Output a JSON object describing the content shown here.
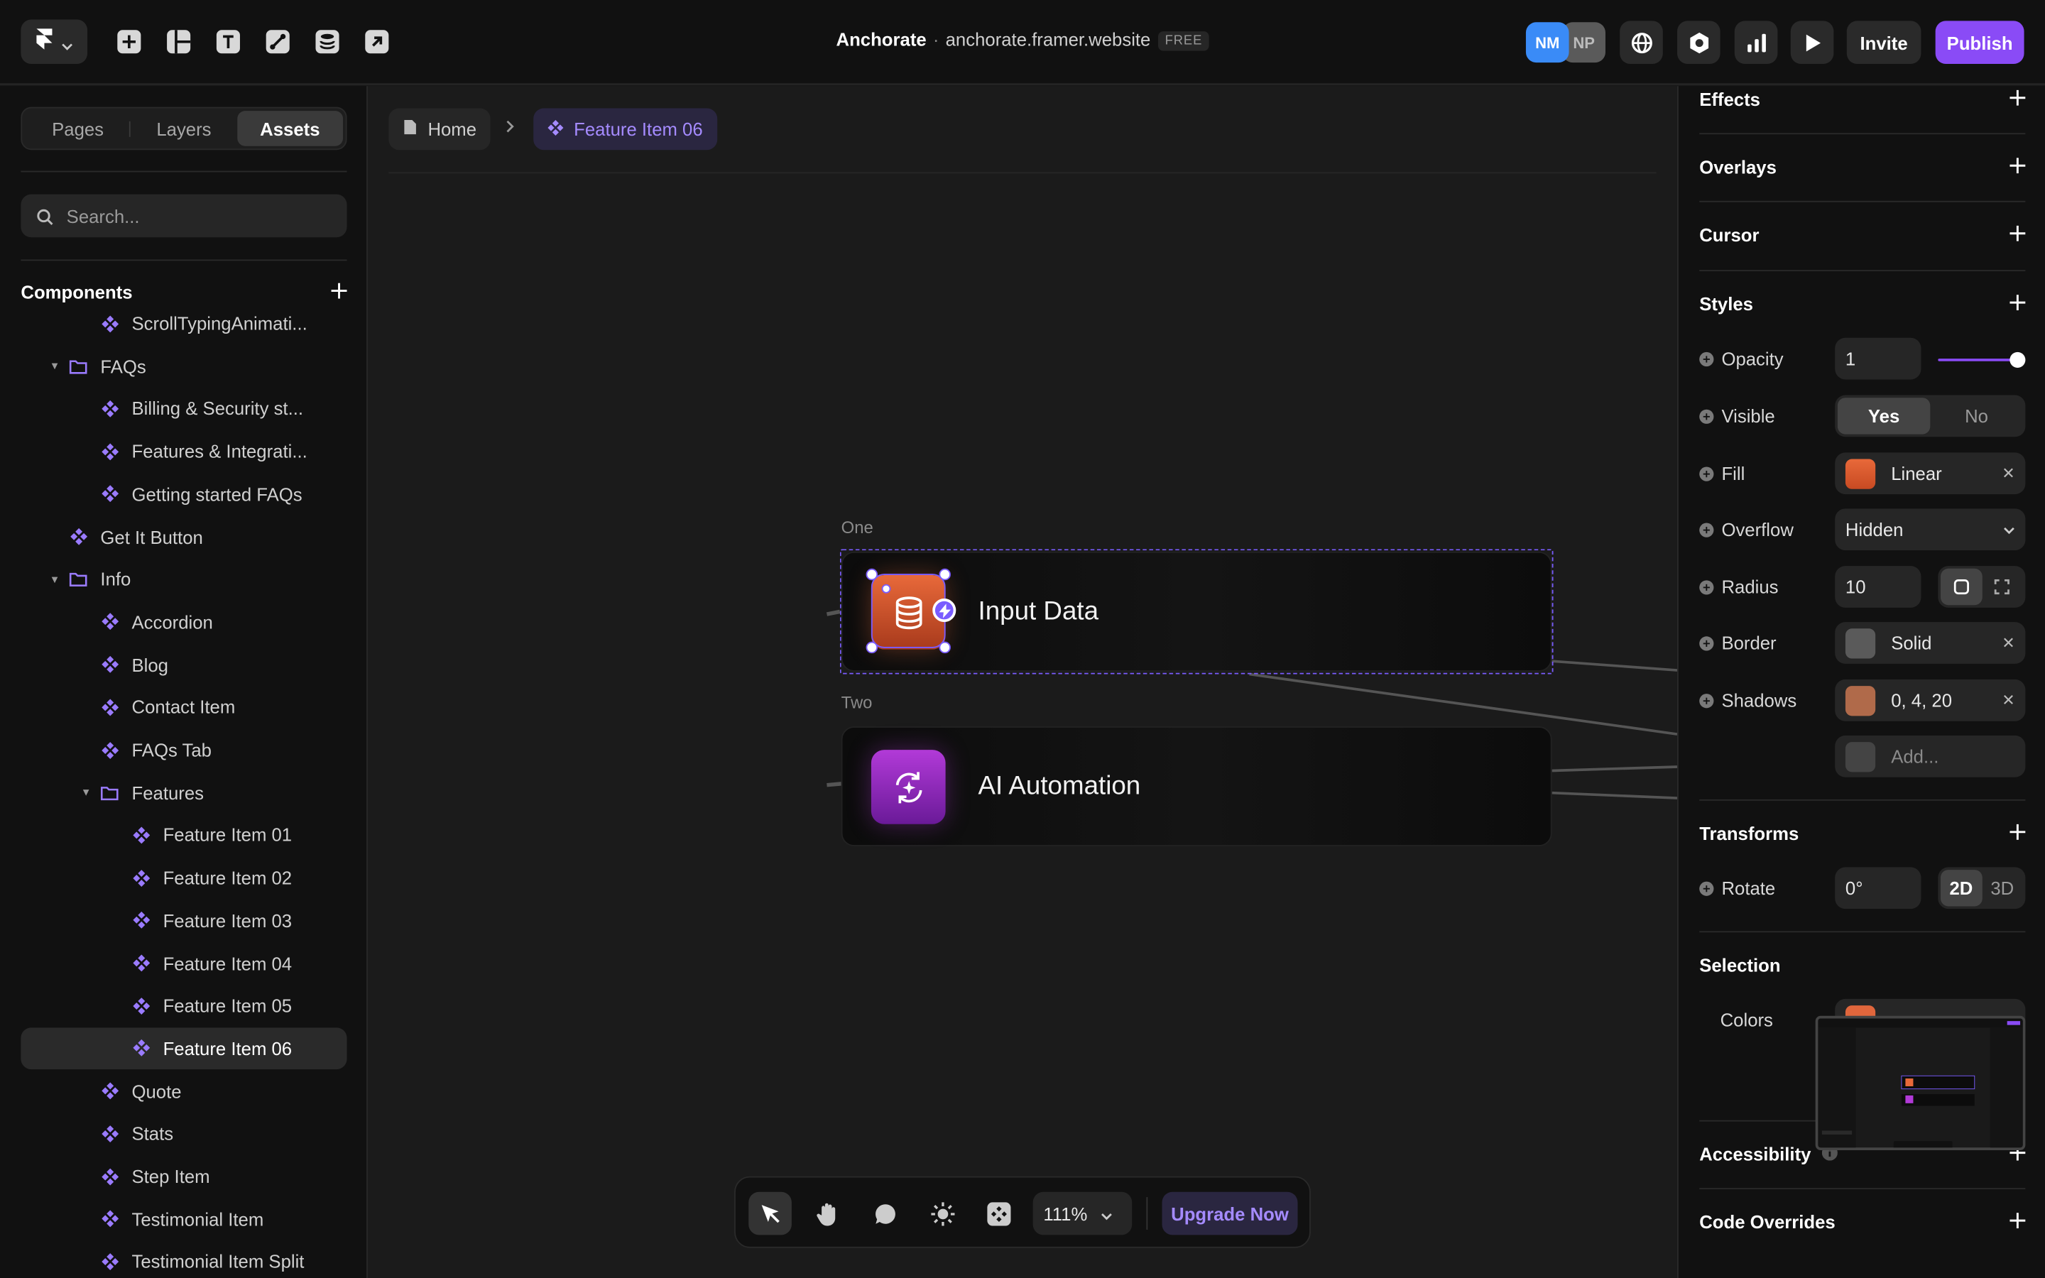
{
  "topbar": {
    "project_name": "Anchorate",
    "separator": "·",
    "site_url": "anchorate.framer.website",
    "plan_badge": "FREE",
    "avatars": [
      {
        "initials": "NM",
        "color": "#3a8bf7"
      },
      {
        "initials": "NP",
        "color": "#5a5a5a"
      }
    ],
    "invite_label": "Invite",
    "publish_label": "Publish",
    "accent": "#8a4bf6",
    "tool_icons": [
      "framer-logo-icon",
      "insert-plus-icon",
      "layout-icon",
      "text-icon",
      "vector-pen-icon",
      "cms-database-icon",
      "external-link-icon"
    ],
    "right_icons": [
      "globe-icon",
      "settings-hexagon-icon",
      "analytics-bars-icon",
      "preview-play-icon"
    ]
  },
  "left": {
    "tabs": [
      {
        "label": "Pages",
        "active": false
      },
      {
        "label": "Layers",
        "active": false
      },
      {
        "label": "Assets",
        "active": true
      }
    ],
    "search_placeholder": "Search...",
    "components_title": "Components",
    "tree": [
      {
        "label": "ScrollTypingAnimati...",
        "type": "component",
        "depth": 2
      },
      {
        "label": "FAQs",
        "type": "folder",
        "depth": 1
      },
      {
        "label": "Billing & Security st...",
        "type": "component",
        "depth": 2
      },
      {
        "label": "Features & Integrati...",
        "type": "component",
        "depth": 2
      },
      {
        "label": "Getting started FAQs",
        "type": "component",
        "depth": 2
      },
      {
        "label": "Get It Button",
        "type": "component",
        "depth": 1
      },
      {
        "label": "Info",
        "type": "folder",
        "depth": 1
      },
      {
        "label": "Accordion",
        "type": "component",
        "depth": 2
      },
      {
        "label": "Blog",
        "type": "component",
        "depth": 2
      },
      {
        "label": "Contact Item",
        "type": "component",
        "depth": 2
      },
      {
        "label": "FAQs Tab",
        "type": "component",
        "depth": 2
      },
      {
        "label": "Features",
        "type": "folder",
        "depth": 2
      },
      {
        "label": "Feature Item 01",
        "type": "component",
        "depth": 3
      },
      {
        "label": "Feature Item 02",
        "type": "component",
        "depth": 3
      },
      {
        "label": "Feature Item 03",
        "type": "component",
        "depth": 3
      },
      {
        "label": "Feature Item 04",
        "type": "component",
        "depth": 3
      },
      {
        "label": "Feature Item 05",
        "type": "component",
        "depth": 3
      },
      {
        "label": "Feature Item 06",
        "type": "component",
        "depth": 3,
        "selected": true
      },
      {
        "label": "Quote",
        "type": "component",
        "depth": 2
      },
      {
        "label": "Stats",
        "type": "component",
        "depth": 2
      },
      {
        "label": "Step Item",
        "type": "component",
        "depth": 2
      },
      {
        "label": "Testimonial Item",
        "type": "component",
        "depth": 2
      },
      {
        "label": "Testimonial Item Split",
        "type": "component",
        "depth": 2
      }
    ]
  },
  "canvas": {
    "breadcrumb": {
      "home": "Home",
      "current": "Feature Item 06"
    },
    "frames": [
      {
        "label": "One",
        "title": "Input Data",
        "icon": "database-icon",
        "gradient": [
          "#e8693a",
          "#a83a1c"
        ]
      },
      {
        "label": "Two",
        "title": "AI Automation",
        "icon": "ai-refresh-icon",
        "gradient": [
          "#b23ad8",
          "#6a1a98"
        ]
      }
    ]
  },
  "bottom_toolbar": {
    "tools": [
      "select-cursor-icon",
      "hand-pan-icon",
      "comment-icon",
      "theme-sun-icon",
      "components-grid-icon"
    ],
    "zoom": "111%",
    "upgrade_label": "Upgrade Now"
  },
  "right": {
    "sections": {
      "effects": "Effects",
      "overlays": "Overlays",
      "cursor": "Cursor",
      "styles": "Styles",
      "transforms": "Transforms",
      "selection": "Selection",
      "accessibility": "Accessibility",
      "code_overrides": "Code Overrides"
    },
    "opacity": {
      "label": "Opacity",
      "value": "1",
      "level": 1
    },
    "visible": {
      "label": "Visible",
      "options": [
        "Yes",
        "No"
      ],
      "selected": "Yes"
    },
    "fill": {
      "label": "Fill",
      "value": "Linear",
      "color": "#e0663c"
    },
    "overflow": {
      "label": "Overflow",
      "value": "Hidden"
    },
    "radius": {
      "label": "Radius",
      "value": "10"
    },
    "border": {
      "label": "Border",
      "value": "Solid",
      "color": "#5a5a5a"
    },
    "shadows": {
      "label": "Shadows",
      "value": "0, 4, 20",
      "color": "#b06a4a"
    },
    "add_placeholder": "Add...",
    "rotate": {
      "label": "Rotate",
      "value": "0°",
      "options": [
        "2D",
        "3D"
      ],
      "selected": "2D"
    },
    "colors_label": "Colors"
  }
}
